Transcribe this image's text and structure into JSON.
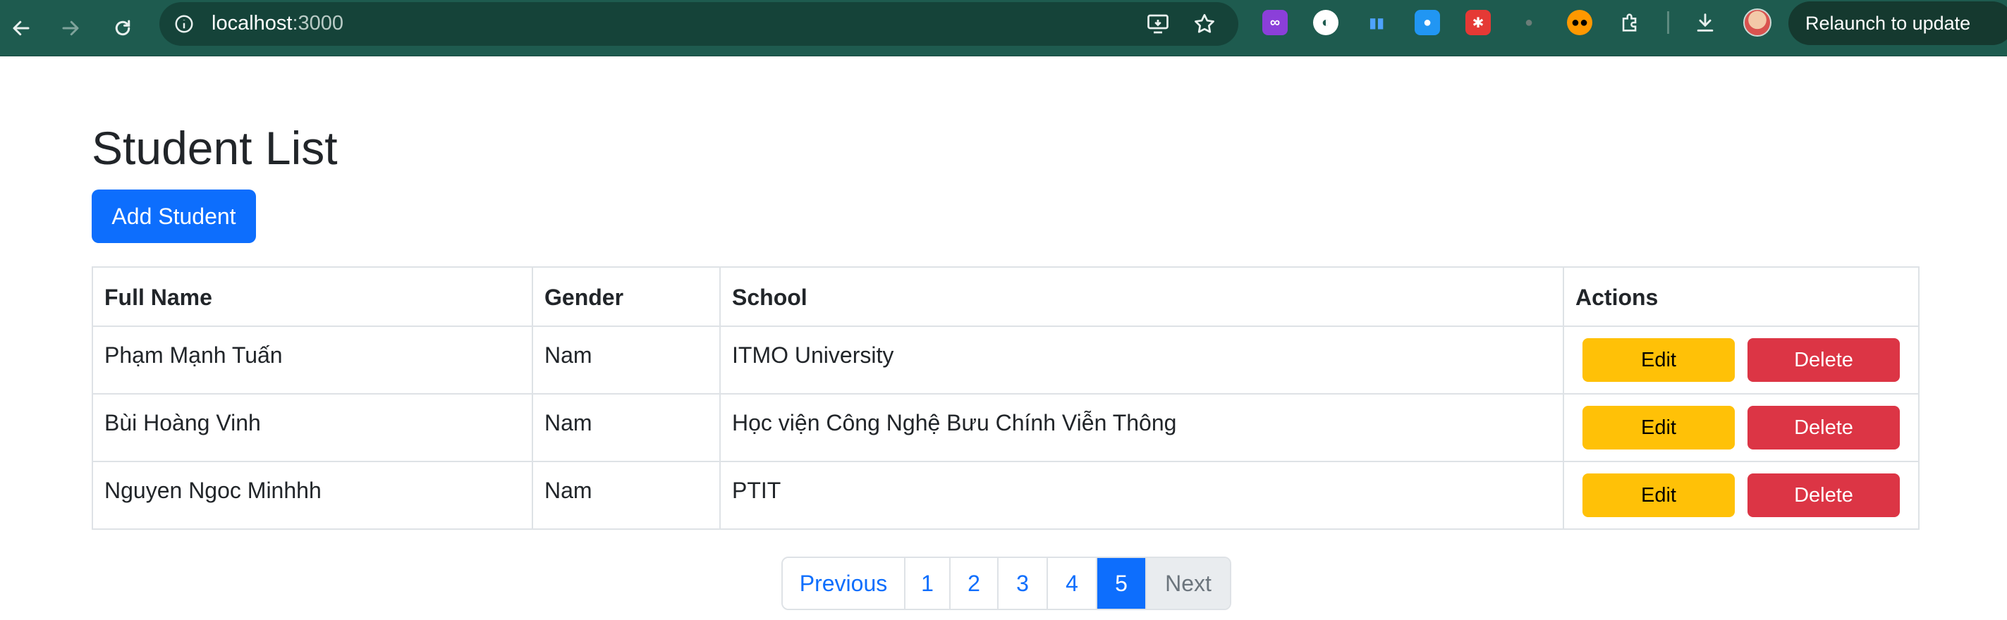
{
  "browser": {
    "url_host": "localhost",
    "url_port": ":3000",
    "relaunch_label": "Relaunch to update"
  },
  "page": {
    "title": "Student List",
    "add_button": "Add Student"
  },
  "table": {
    "headers": [
      "Full Name",
      "Gender",
      "School",
      "Actions"
    ],
    "rows": [
      {
        "full_name": "Phạm Mạnh Tuấn",
        "gender": "Nam",
        "school": "ITMO University"
      },
      {
        "full_name": "Bùi Hoàng Vinh",
        "gender": "Nam",
        "school": "Học viện Công Nghệ Bưu Chính Viễn Thông"
      },
      {
        "full_name": "Nguyen Ngoc Minhhh",
        "gender": "Nam",
        "school": "PTIT"
      }
    ],
    "edit_label": "Edit",
    "delete_label": "Delete"
  },
  "pagination": {
    "previous": "Previous",
    "pages": [
      "1",
      "2",
      "3",
      "4",
      "5"
    ],
    "active_page": "5",
    "next": "Next"
  },
  "colors": {
    "primary": "#0d6efd",
    "warning": "#ffc107",
    "danger": "#dc3545",
    "chrome": "#1e5b4f"
  }
}
